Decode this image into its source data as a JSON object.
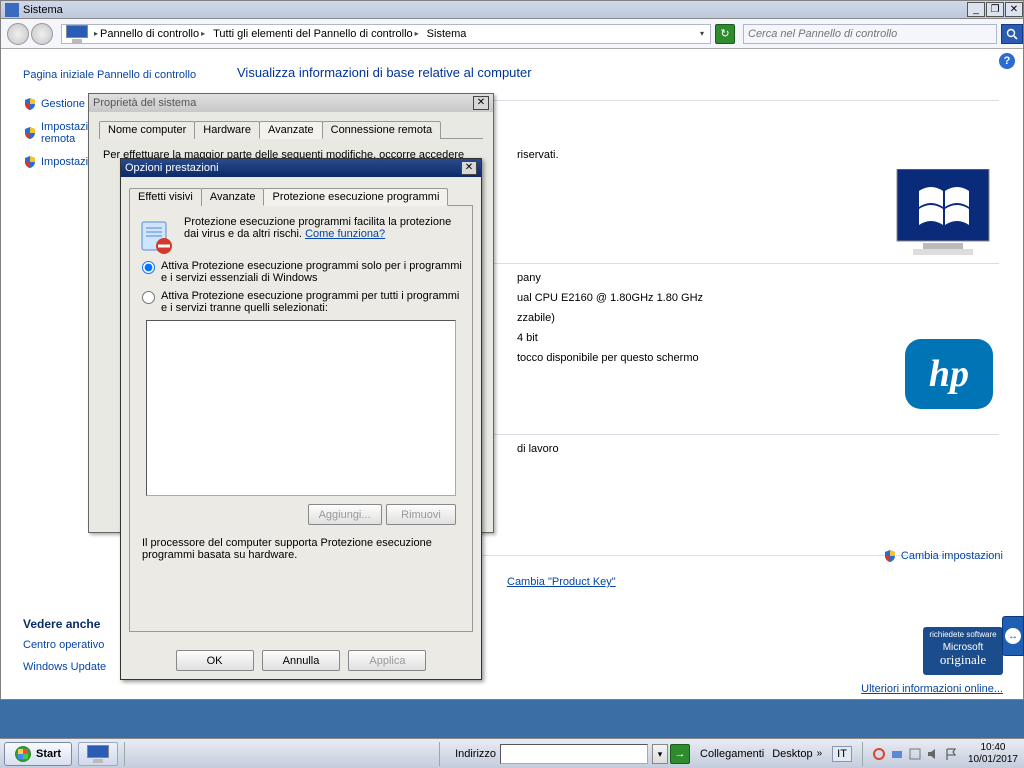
{
  "window_title": "Sistema",
  "address_bar": {
    "segments": [
      "Pannello di controllo",
      "Tutti gli elementi del Pannello di controllo",
      "Sistema"
    ]
  },
  "search_placeholder": "Cerca nel Pannello di controllo",
  "sidebar": {
    "home_link": "Pagina iniziale Pannello di controllo",
    "links": [
      "Gestione dispositivi",
      "Impostazioni di connessione remota",
      "Impostazioni di sistema avanzate"
    ],
    "see_also_hdr": "Vedere anche",
    "see_also": [
      "Centro operativo",
      "Windows Update"
    ]
  },
  "content": {
    "heading": "Visualizza informazioni di base relative al computer",
    "rights": "riservati.",
    "system": {
      "manufacturer_suffix": "pany",
      "cpu": "ual CPU  E2160  @ 1.80GHz  1.80 GHz",
      "ram_suffix": "zzabile)",
      "arch": "4 bit",
      "touch": "tocco disponibile per questo schermo",
      "workgroup": "di lavoro",
      "product_key": "Cambia \"Product Key\""
    },
    "change_settings": "Cambia impostazioni",
    "more_info": "Ulteriori informazioni online...",
    "ms_badge_line1": "richiedete software",
    "ms_badge_line2": "Microsoft",
    "ms_badge_line3": "originale"
  },
  "dlg1": {
    "title": "Proprietà del sistema",
    "tabs": [
      "Nome computer",
      "Hardware",
      "Avanzate",
      "Connessione remota"
    ],
    "active_tab": 2,
    "body_intro": "Per effettuare la maggior parte delle seguenti modifiche, occorre accedere"
  },
  "dlg2": {
    "title": "Opzioni prestazioni",
    "tabs": [
      "Effetti visivi",
      "Avanzate",
      "Protezione esecuzione programmi"
    ],
    "active_tab": 2,
    "dep_text": "Protezione esecuzione programmi facilita la protezione dai virus e da altri rischi.",
    "dep_link": "Come funziona?",
    "radio1": "Attiva Protezione esecuzione programmi solo per i programmi e i servizi essenziali di Windows",
    "radio2": "Attiva Protezione esecuzione programmi per tutti i programmi e i servizi tranne quelli selezionati:",
    "selected_radio": 1,
    "add_btn": "Aggiungi...",
    "remove_btn": "Rimuovi",
    "note": "Il processore del computer supporta Protezione esecuzione programmi basata su hardware.",
    "ok": "OK",
    "cancel": "Annulla",
    "apply": "Applica"
  },
  "taskbar": {
    "start": "Start",
    "address_label": "Indirizzo",
    "links_label": "Collegamenti",
    "desktop": "Desktop",
    "lang": "IT",
    "time": "10:40",
    "date": "10/01/2017"
  }
}
